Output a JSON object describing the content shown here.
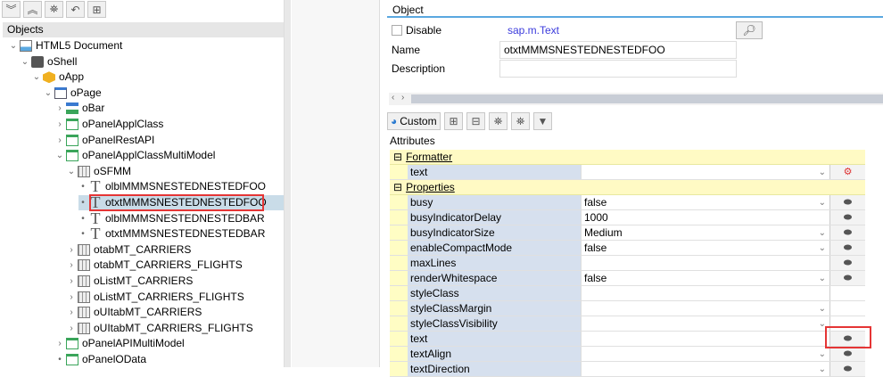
{
  "left": {
    "toolbar": [
      {
        "icon": "expand-all-icon",
        "glyph": "︾"
      },
      {
        "icon": "collapse-all-icon",
        "glyph": "︽"
      },
      {
        "icon": "binoculars-icon",
        "glyph": "⛯"
      },
      {
        "icon": "undo-icon",
        "glyph": "↶"
      },
      {
        "icon": "hierarchy-icon",
        "glyph": "⊞"
      }
    ],
    "header": "Objects",
    "tree": [
      {
        "label": "HTML5 Document",
        "level": 0,
        "arrow": "⌄",
        "icon": "document"
      },
      {
        "label": "oShell",
        "level": 1,
        "arrow": "⌄",
        "icon": "shell"
      },
      {
        "label": "oApp",
        "level": 2,
        "arrow": "⌄",
        "icon": "app"
      },
      {
        "label": "oPage",
        "level": 3,
        "arrow": "⌄",
        "icon": "page"
      },
      {
        "label": "oBar",
        "level": 4,
        "arrow": "›",
        "icon": "bar"
      },
      {
        "label": "oPanelApplClass",
        "level": 4,
        "arrow": "›",
        "icon": "panel"
      },
      {
        "label": "oPanelRestAPI",
        "level": 4,
        "arrow": "›",
        "icon": "panel"
      },
      {
        "label": "oPanelApplClassMultiModel",
        "level": 4,
        "arrow": "⌄",
        "icon": "panel"
      },
      {
        "label": "oSFMM",
        "level": 5,
        "arrow": "⌄",
        "icon": "form"
      },
      {
        "label": "olblMMMSNESTEDNESTEDFOO",
        "level": 6,
        "arrow": "•",
        "icon": "T"
      },
      {
        "label": "otxtMMMSNESTEDNESTEDFOO",
        "level": 6,
        "arrow": "•",
        "icon": "T",
        "selected": true
      },
      {
        "label": "olblMMMSNESTEDNESTEDBAR",
        "level": 6,
        "arrow": "•",
        "icon": "T"
      },
      {
        "label": "otxtMMMSNESTEDNESTEDBAR",
        "level": 6,
        "arrow": "•",
        "icon": "T"
      },
      {
        "label": "otabMT_CARRIERS",
        "level": 5,
        "arrow": "›",
        "icon": "tab"
      },
      {
        "label": "otabMT_CARRIERS_FLIGHTS",
        "level": 5,
        "arrow": "›",
        "icon": "tab"
      },
      {
        "label": "oListMT_CARRIERS",
        "level": 5,
        "arrow": "›",
        "icon": "tab"
      },
      {
        "label": "oListMT_CARRIERS_FLIGHTS",
        "level": 5,
        "arrow": "›",
        "icon": "tab"
      },
      {
        "label": "oUItabMT_CARRIERS",
        "level": 5,
        "arrow": "›",
        "icon": "tab"
      },
      {
        "label": "oUItabMT_CARRIERS_FLIGHTS",
        "level": 5,
        "arrow": "›",
        "icon": "tab"
      },
      {
        "label": "oPanelAPIMultiModel",
        "level": 4,
        "arrow": "›",
        "icon": "panel"
      },
      {
        "label": "oPanelOData",
        "level": 4,
        "arrow": "•",
        "icon": "panel"
      }
    ]
  },
  "object": {
    "header": "Object",
    "disable_label": "Disable",
    "disable_checked": false,
    "type": "sap.m.Text",
    "name_label": "Name",
    "name_value": "otxtMMMSNESTEDNESTEDFOO",
    "description_label": "Description",
    "description_value": ""
  },
  "attributes": {
    "custom_label": "Custom",
    "header": "Attributes",
    "formatter_section": "Formatter",
    "formatter_rows": [
      {
        "name": "text",
        "value": "",
        "dropdown": true
      }
    ],
    "properties_section": "Properties",
    "rows": [
      {
        "name": "busy",
        "value": "false",
        "dropdown": true,
        "button": true
      },
      {
        "name": "busyIndicatorDelay",
        "value": "1000",
        "dropdown": false,
        "button": true
      },
      {
        "name": "busyIndicatorSize",
        "value": "Medium",
        "dropdown": true,
        "button": true
      },
      {
        "name": "enableCompactMode",
        "value": "false",
        "dropdown": true,
        "button": true
      },
      {
        "name": "maxLines",
        "value": "",
        "dropdown": false,
        "button": true
      },
      {
        "name": "renderWhitespace",
        "value": "false",
        "dropdown": true,
        "button": true
      },
      {
        "name": "styleClass",
        "value": "",
        "dropdown": false,
        "button": false
      },
      {
        "name": "styleClassMargin",
        "value": "",
        "dropdown": true,
        "button": false
      },
      {
        "name": "styleClassVisibility",
        "value": "",
        "dropdown": true,
        "button": false
      },
      {
        "name": "text",
        "value": "",
        "dropdown": false,
        "button": true
      },
      {
        "name": "textAlign",
        "value": "",
        "dropdown": true,
        "button": true
      },
      {
        "name": "textDirection",
        "value": "",
        "dropdown": true,
        "button": true
      }
    ]
  },
  "colors": {
    "highlight": "#e53535",
    "accent": "#5aa8e0",
    "type_link": "#3b3bdc",
    "section_bg": "#fffac4",
    "name_col_bg": "#d6e0ee"
  }
}
